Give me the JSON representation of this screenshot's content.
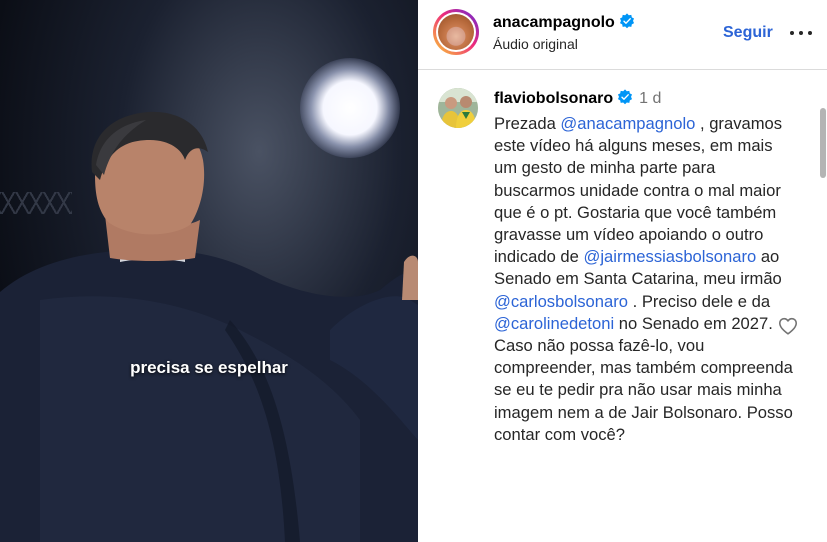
{
  "video": {
    "caption": "precisa se espelhar"
  },
  "header": {
    "username": "anacampagnolo",
    "audio_label": "Áudio original",
    "follow_label": "Seguir"
  },
  "comment": {
    "username": "flaviobolsonaro",
    "time": "1 d",
    "parts": {
      "p1": "Prezada ",
      "m1": "@anacampagnolo",
      "p2": " , gravamos este vídeo há alguns meses, em mais um gesto de minha parte para buscarmos unidade contra o mal maior que é o pt. Gostaria que você também gravasse um vídeo apoiando o outro indicado de ",
      "m2": "@jairmessiasbolsonaro",
      "p3": " ao Senado em Santa Catarina, meu irmão ",
      "m3": "@carlosbolsonaro",
      "p4": " . Preciso dele e da ",
      "m4": "@carolinedetoni",
      "p5": " no Senado em 2027.",
      "p6": "Caso não possa fazê-lo, vou compreender, mas também compreenda se eu te pedir pra não usar mais minha imagem nem a de Jair Bolsonaro. Posso contar com você?"
    }
  },
  "colors": {
    "link": "#2c64d6",
    "verified": "#0095f6"
  },
  "icons": {
    "verified": "verified-badge-icon",
    "more": "more-options-icon",
    "like": "heart-icon"
  }
}
